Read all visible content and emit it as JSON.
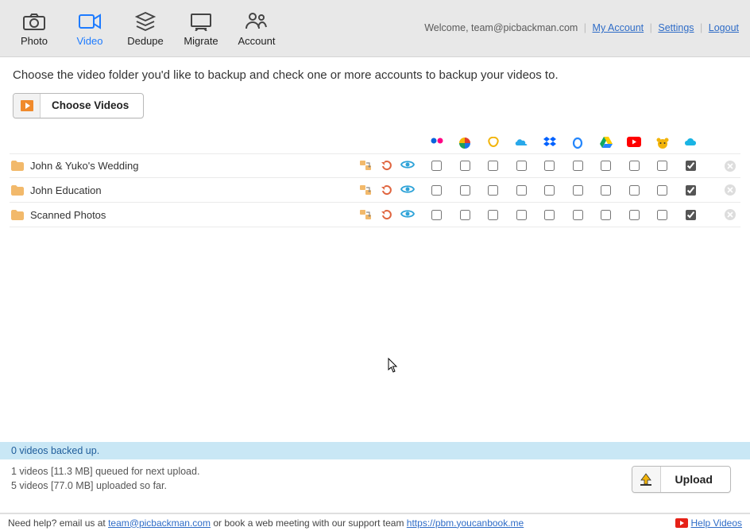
{
  "toolbar": {
    "items": [
      {
        "label": "Photo"
      },
      {
        "label": "Video"
      },
      {
        "label": "Dedupe"
      },
      {
        "label": "Migrate"
      },
      {
        "label": "Account"
      }
    ]
  },
  "account_bar": {
    "welcome_prefix": "Welcome, ",
    "email": "team@picbackman.com",
    "my_account": "My Account",
    "settings": "Settings",
    "logout": "Logout"
  },
  "instruction": "Choose the video folder you'd like to backup and check one or more accounts to backup your videos to.",
  "choose_button": "Choose Videos",
  "services": [
    "flickr",
    "google-photos",
    "smugmug",
    "onedrive",
    "dropbox",
    "box",
    "google-drive",
    "youtube",
    "bear",
    "pcloud"
  ],
  "folders": [
    {
      "name": "John & Yuko's Wedding",
      "checks": [
        false,
        false,
        false,
        false,
        false,
        false,
        false,
        false,
        false,
        true
      ]
    },
    {
      "name": "John Education",
      "checks": [
        false,
        false,
        false,
        false,
        false,
        false,
        false,
        false,
        false,
        true
      ]
    },
    {
      "name": "Scanned Photos",
      "checks": [
        false,
        false,
        false,
        false,
        false,
        false,
        false,
        false,
        false,
        true
      ]
    }
  ],
  "status": {
    "backed_up": "0 videos backed up.",
    "queued": "1 videos [11.3 MB] queued for next upload.",
    "uploaded": "5 videos [77.0 MB] uploaded so far."
  },
  "upload_button": "Upload",
  "footer": {
    "help_prefix": "Need help? email us at ",
    "help_email": "team@picbackman.com",
    "help_mid": " or book a web meeting with our support team ",
    "help_book_url": "https://pbm.youcanbook.me",
    "help_videos": "Help Videos"
  }
}
